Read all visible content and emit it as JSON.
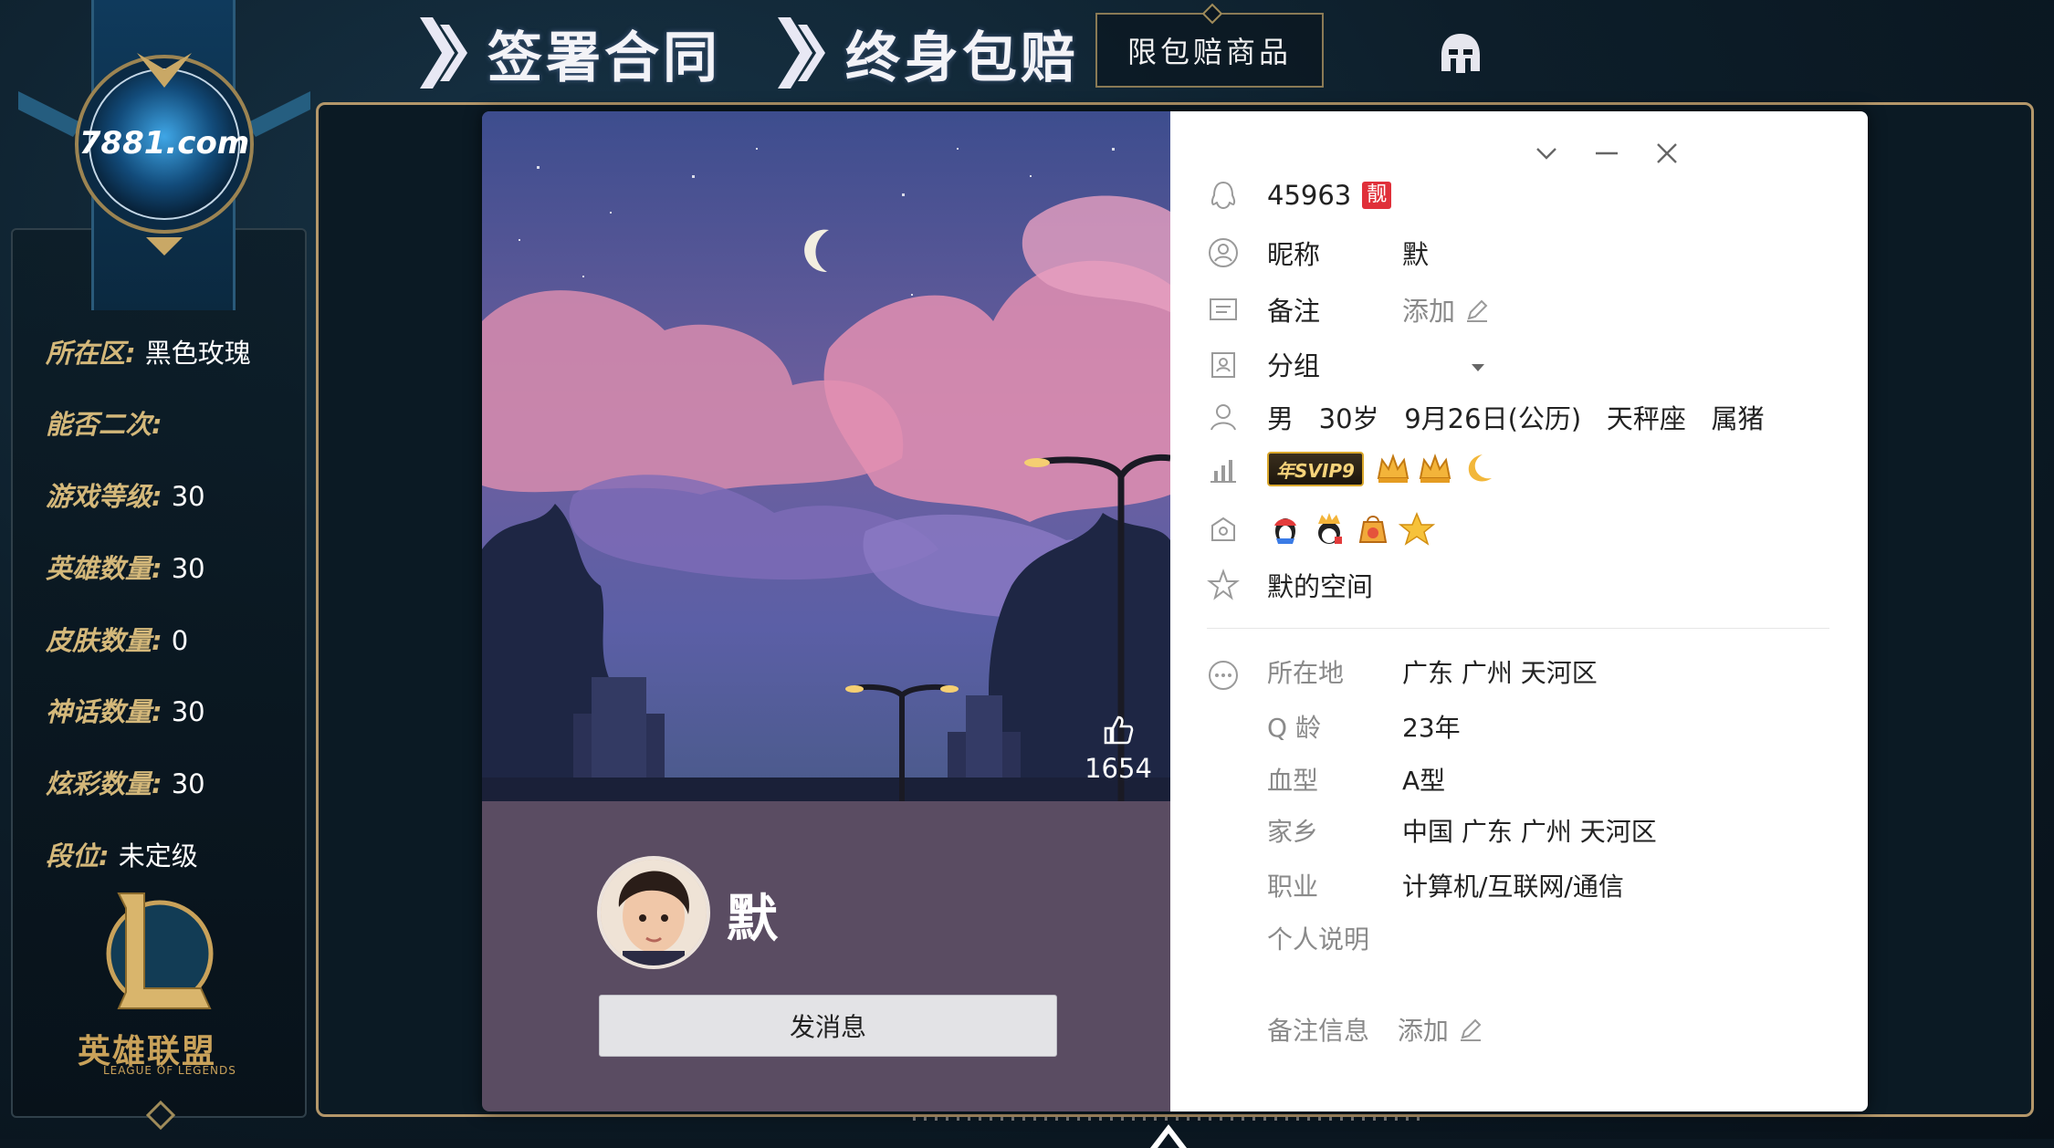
{
  "header": {
    "item1": "签署合同",
    "item2": "终身包赔",
    "box_label": "限包赔商品"
  },
  "sidebar": {
    "logo_text": "7881.com",
    "stats": [
      {
        "key": "所在区",
        "value": "黑色玫瑰"
      },
      {
        "key": "能否二次",
        "value": ""
      },
      {
        "key": "游戏等级",
        "value": "30"
      },
      {
        "key": "英雄数量",
        "value": "30"
      },
      {
        "key": "皮肤数量",
        "value": "0"
      },
      {
        "key": "神话数量",
        "value": "30"
      },
      {
        "key": "炫彩数量",
        "value": "30"
      },
      {
        "key": "段位",
        "value": "未定级"
      }
    ],
    "game_logo_cn": "英雄联盟",
    "game_logo_en": "LEAGUE OF LEGENDS"
  },
  "profile": {
    "likes": "1654",
    "nickname_big": "默",
    "send_message": "发消息",
    "qq_number": "45963",
    "qq_tag": "靓",
    "nickname_label": "昵称",
    "nickname_value": "默",
    "remark_label": "备注",
    "remark_add": "添加",
    "group_label": "分组",
    "basic_info": "男   30岁   9月26日(公历)   天秤座   属猪",
    "svip_badge": "年SVIP9",
    "space_label": "默的空间",
    "details": [
      {
        "label": "所在地",
        "value": "广东 广州 天河区"
      },
      {
        "label": "Q 龄",
        "value": "23年"
      },
      {
        "label": "血型",
        "value": "A型"
      },
      {
        "label": "家乡",
        "value": "中国 广东 广州 天河区"
      },
      {
        "label": "职业",
        "value": "计算机/互联网/通信"
      },
      {
        "label": "个人说明",
        "value": ""
      }
    ],
    "remark_info_label": "备注信息",
    "remark_info_add": "添加"
  },
  "colors": {
    "frame_gold": "#b4976a",
    "stat_key": "#d4b87a",
    "card_left_bg": "#5a4c62",
    "qq_tag_red": "#e0303a"
  }
}
